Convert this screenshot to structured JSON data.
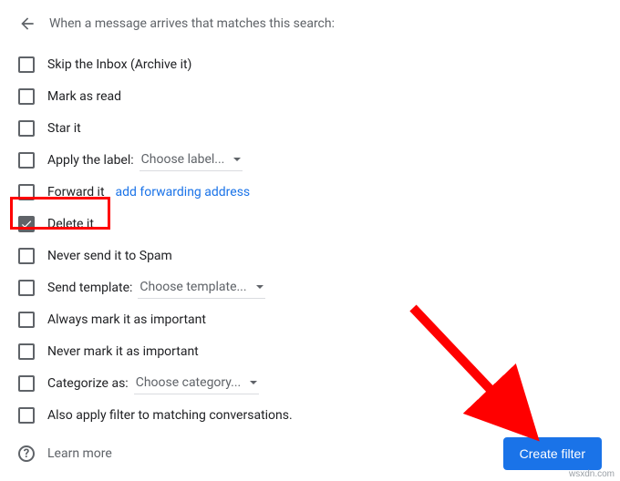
{
  "header": {
    "title": "When a message arrives that matches this search:"
  },
  "options": {
    "skip_inbox": "Skip the Inbox (Archive it)",
    "mark_read": "Mark as read",
    "star": "Star it",
    "apply_label": "Apply the label:",
    "apply_label_dropdown": "Choose label...",
    "forward": "Forward it",
    "forward_link": "add forwarding address",
    "delete": "Delete it",
    "never_spam": "Never send it to Spam",
    "send_template": "Send template:",
    "send_template_dropdown": "Choose template...",
    "always_important": "Always mark it as important",
    "never_important": "Never mark it as important",
    "categorize": "Categorize as:",
    "categorize_dropdown": "Choose category...",
    "apply_matching": "Also apply filter to matching conversations."
  },
  "footer": {
    "learn_more": "Learn more",
    "create_button": "Create filter"
  },
  "watermark": "wsxdn.com"
}
